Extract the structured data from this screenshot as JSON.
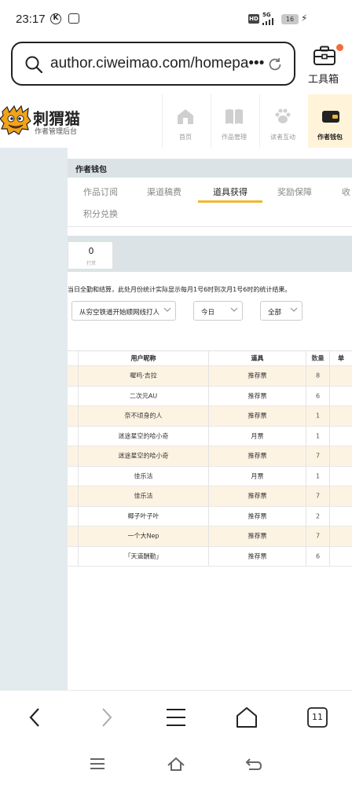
{
  "status_bar": {
    "time": "23:17",
    "network": "5G",
    "hd": "HD",
    "battery": "16"
  },
  "browser": {
    "url": "author.ciweimao.com/homepa•••",
    "toolbox_label": "工具箱",
    "tab_count": "11"
  },
  "site": {
    "logo_name": "刺猬猫",
    "logo_sub": "作者管理后台",
    "nav": [
      {
        "label": "首页",
        "icon": "house-icon"
      },
      {
        "label": "作品管理",
        "icon": "book-icon"
      },
      {
        "label": "读者互动",
        "icon": "paw-icon"
      },
      {
        "label": "作者钱包",
        "icon": "wallet-icon"
      }
    ]
  },
  "wallet": {
    "title": "作者钱包",
    "tabs": [
      "作品订阅",
      "渠道稿费",
      "道具获得",
      "奖励保障",
      "收",
      "积分兑换"
    ],
    "active_tab": "道具获得",
    "stat_value": "0",
    "stat_label": "打赏",
    "notice": "当日全勤和结算，此处月份统计实际显示每月1号6时到次月1号6时的统计结果。",
    "filters": {
      "book": "从穷空铁道开始顺网线打人",
      "date": "今日",
      "type": "全部"
    }
  },
  "table": {
    "headers": [
      "",
      "用户昵称",
      "道具",
      "数量",
      "单"
    ],
    "rows": [
      {
        "name": "喔呜·吉拉",
        "item": "推荐票",
        "qty": "8"
      },
      {
        "name": "二次元AU",
        "item": "推荐票",
        "qty": "6"
      },
      {
        "name": "奈不顷身的人",
        "item": "推荐票",
        "qty": "1"
      },
      {
        "name": "迷途星空的哈小奇",
        "item": "月票",
        "qty": "1"
      },
      {
        "name": "迷途星空的哈小奇",
        "item": "推荐票",
        "qty": "7"
      },
      {
        "name": "佳乐洁",
        "item": "月票",
        "qty": "1"
      },
      {
        "name": "佳乐洁",
        "item": "推荐票",
        "qty": "7"
      },
      {
        "name": "椰子叶子叶",
        "item": "推荐票",
        "qty": "2"
      },
      {
        "name": "一个大Nep",
        "item": "推荐票",
        "qty": "7"
      },
      {
        "name": "「天道酬勤」",
        "item": "推荐票",
        "qty": "6"
      }
    ]
  },
  "colors": {
    "accent": "#f2b730",
    "row_alt": "#fdf3e3",
    "panel": "#e3ebee"
  }
}
